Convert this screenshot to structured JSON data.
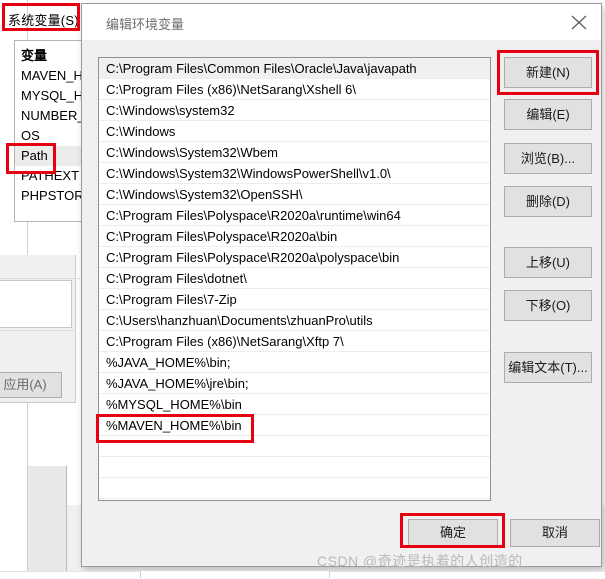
{
  "background_window": {
    "section_label": "系统变量(S)",
    "variable_list": {
      "header": "变量",
      "items": [
        {
          "name": "MAVEN_HO",
          "selected": false
        },
        {
          "name": "MYSQL_HO",
          "selected": false
        },
        {
          "name": "NUMBER_C",
          "selected": false
        },
        {
          "name": "OS",
          "selected": false
        },
        {
          "name": "Path",
          "selected": true
        },
        {
          "name": "PATHEXT",
          "selected": false
        },
        {
          "name": "PHPSTORM",
          "selected": false
        }
      ]
    },
    "apply_button": "应用(A)"
  },
  "dialog": {
    "title": "编辑环境变量",
    "close_icon": "close-icon",
    "path_entries": [
      {
        "value": "C:\\Program Files\\Common Files\\Oracle\\Java\\javapath",
        "selected": true
      },
      {
        "value": "C:\\Program Files (x86)\\NetSarang\\Xshell 6\\",
        "selected": false
      },
      {
        "value": "C:\\Windows\\system32",
        "selected": false
      },
      {
        "value": "C:\\Windows",
        "selected": false
      },
      {
        "value": "C:\\Windows\\System32\\Wbem",
        "selected": false
      },
      {
        "value": "C:\\Windows\\System32\\WindowsPowerShell\\v1.0\\",
        "selected": false
      },
      {
        "value": "C:\\Windows\\System32\\OpenSSH\\",
        "selected": false
      },
      {
        "value": "C:\\Program Files\\Polyspace\\R2020a\\runtime\\win64",
        "selected": false
      },
      {
        "value": "C:\\Program Files\\Polyspace\\R2020a\\bin",
        "selected": false
      },
      {
        "value": "C:\\Program Files\\Polyspace\\R2020a\\polyspace\\bin",
        "selected": false
      },
      {
        "value": "C:\\Program Files\\dotnet\\",
        "selected": false
      },
      {
        "value": "C:\\Program Files\\7-Zip",
        "selected": false
      },
      {
        "value": "C:\\Users\\hanzhuan\\Documents\\zhuanPro\\utils",
        "selected": false
      },
      {
        "value": "C:\\Program Files (x86)\\NetSarang\\Xftp 7\\",
        "selected": false
      },
      {
        "value": "%JAVA_HOME%\\bin;",
        "selected": false
      },
      {
        "value": "%JAVA_HOME%\\jre\\bin;",
        "selected": false
      },
      {
        "value": "%MYSQL_HOME%\\bin",
        "selected": false
      },
      {
        "value": "%MAVEN_HOME%\\bin",
        "selected": false
      },
      {
        "value": "",
        "selected": false
      },
      {
        "value": "",
        "selected": false
      },
      {
        "value": "",
        "selected": false
      }
    ],
    "side_buttons": {
      "new": "新建(N)",
      "edit": "编辑(E)",
      "browse": "浏览(B)...",
      "delete": "删除(D)",
      "move_up": "上移(U)",
      "move_down": "下移(O)",
      "edit_text": "编辑文本(T)..."
    },
    "bottom_buttons": {
      "ok": "确定",
      "cancel": "取消"
    }
  },
  "annotations": {
    "highlight_color": "#e60012",
    "boxes": [
      "系统变量(S)",
      "Path",
      "新建(N)",
      "%MAVEN_HOME%\\bin",
      "确定"
    ]
  },
  "watermark": {
    "text": "CSDN @奇迹是执着的人创造的"
  }
}
